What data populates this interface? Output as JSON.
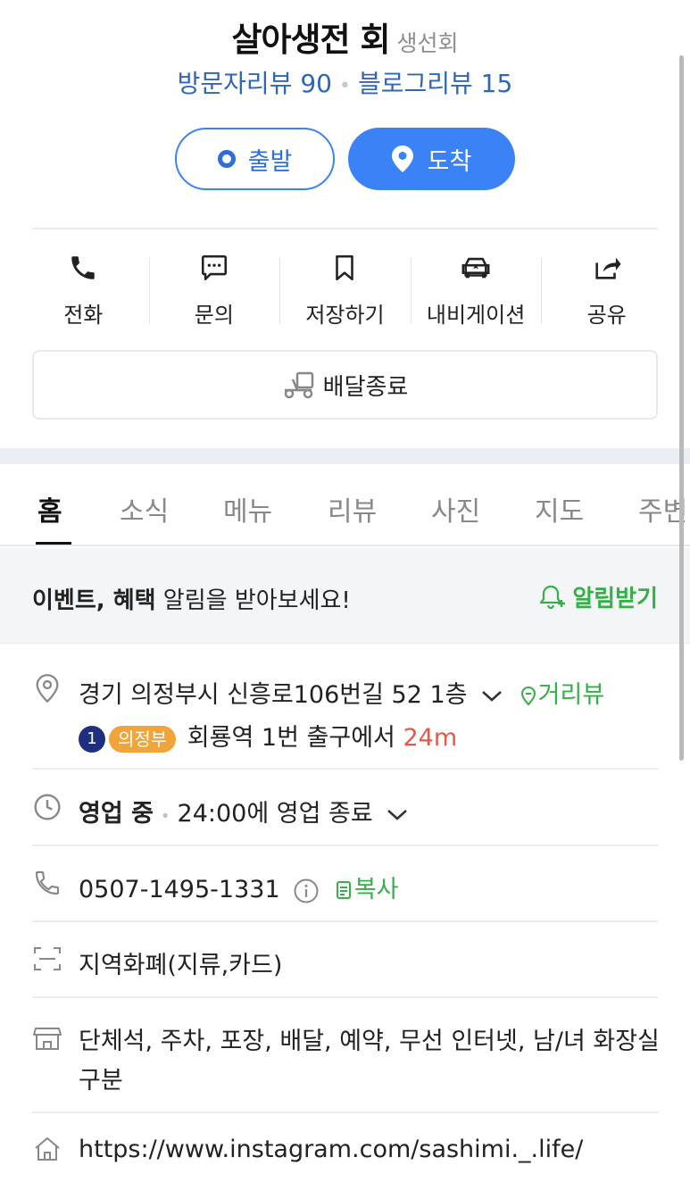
{
  "place": {
    "name": "살아생전 회",
    "category": "생선회",
    "visitor_reviews": "방문자리뷰 90",
    "blog_reviews": "블로그리뷰 15"
  },
  "route": {
    "start_label": "출발",
    "arrive_label": "도착"
  },
  "actions": [
    {
      "label": "전화",
      "icon": "phone-icon"
    },
    {
      "label": "문의",
      "icon": "chat-icon"
    },
    {
      "label": "저장하기",
      "icon": "bookmark-icon"
    },
    {
      "label": "내비게이션",
      "icon": "car-navigation-icon"
    },
    {
      "label": "공유",
      "icon": "share-icon"
    }
  ],
  "delivery": {
    "label": "배달종료",
    "icon": "delivery-scooter-icon"
  },
  "tabs": [
    "홈",
    "소식",
    "메뉴",
    "리뷰",
    "사진",
    "지도",
    "주변"
  ],
  "active_tab": "홈",
  "alert": {
    "bold_text": "이벤트, 혜택",
    "text": " 알림을 받아보세요!",
    "button": "알림받기"
  },
  "address": {
    "text": "경기 의정부시 신흥로106번길 52 1층",
    "street_view": "거리뷰",
    "line_number": "1",
    "line_badge": "의정부",
    "station": "회룡역",
    "exit_text": " 1번 출구에서 ",
    "distance": "24m"
  },
  "hours": {
    "status": "영업 중",
    "detail": "24:00에 영업 종료"
  },
  "phone": {
    "number": "0507-1495-1331",
    "copy": "복사"
  },
  "payment": "지역화폐(지류,카드)",
  "amenities": {
    "line1": "단체석, 주차, 포장, 배달, 예약, 무선 인터넷, 남/녀 화장실",
    "line2": "구분"
  },
  "website": "https://www.instagram.com/sashimi._.life/",
  "colors": {
    "primary_blue": "#3b82f6",
    "review_blue": "#2f66b8",
    "green": "#35b048",
    "distance_red": "#e05a4a",
    "line_badge_orange": "#f0a43a",
    "line_number_navy": "#1f2f80"
  }
}
